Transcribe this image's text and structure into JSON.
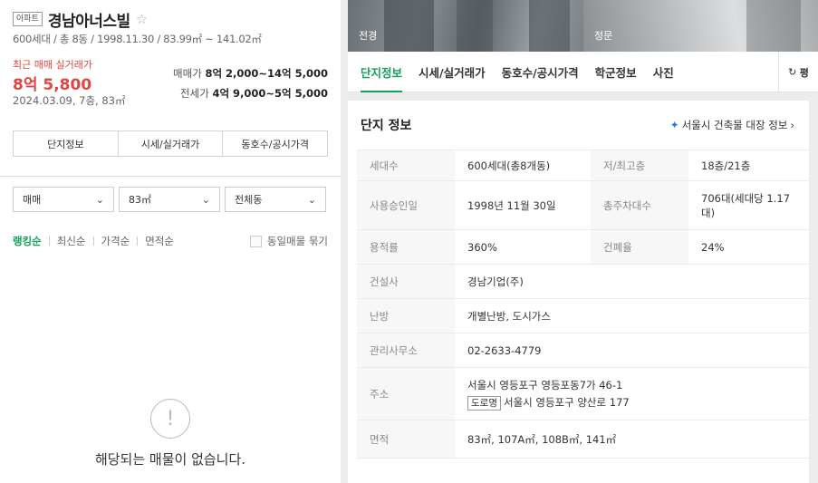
{
  "listing": {
    "type_badge": "아파트",
    "name": "경남아너스빌",
    "star": "☆",
    "summary": "600세대 / 총 8동 / 1998.11.30 / 83.99㎡ ~ 141.02㎡",
    "recent_label": "최근 매매 실거래가",
    "recent_price": "8억 5,800",
    "recent_date": "2024.03.09, 7층, 83㎡",
    "sale_range_label": "매매가",
    "sale_range_value": "8억 2,000~14억 5,000",
    "jeonse_range_label": "전세가",
    "jeonse_range_value": "4억 9,000~5억 5,000",
    "tabs": [
      "단지정보",
      "시세/실거래가",
      "동호수/공시가격"
    ]
  },
  "filters": {
    "deal_type": "매매",
    "area": "83㎡",
    "dong": "전체동"
  },
  "sort": {
    "items": [
      "랭킹순",
      "최신순",
      "가격순",
      "면적순"
    ],
    "same_group_label": "동일매물 묶기"
  },
  "empty_state": {
    "icon": "!",
    "message": "해당되는 매물이 없습니다."
  },
  "photos": [
    {
      "label": "전경"
    },
    {
      "label": "정문"
    }
  ],
  "nav": {
    "items": [
      "단지정보",
      "시세/실거래가",
      "동호수/공시가격",
      "학군정보",
      "사진"
    ],
    "more_label": "평"
  },
  "info": {
    "title": "단지 정보",
    "link_label": "서울시 건축물 대장 정보",
    "rows": [
      {
        "k1": "세대수",
        "v1": "600세대(총8개동)",
        "k2": "저/최고층",
        "v2": "18층/21층"
      },
      {
        "k1": "사용승인일",
        "v1": "1998년 11월 30일",
        "k2": "총주차대수",
        "v2": "706대(세대당 1.17대)"
      },
      {
        "k1": "용적률",
        "v1": "360%",
        "k2": "건폐율",
        "v2": "24%"
      },
      {
        "k1": "건설사",
        "v1": "경남기업(주)"
      },
      {
        "k1": "난방",
        "v1": "개별난방, 도시가스"
      },
      {
        "k1": "관리사무소",
        "v1": "02-2633-4779"
      },
      {
        "k1": "주소",
        "v1": "서울시 영등포구 영등포동7가 46-1",
        "road_badge": "도로명",
        "v1b": "서울시 영등포구 양산로 177"
      },
      {
        "k1": "면적",
        "v1": "83㎡, 107A㎡, 108B㎡, 141㎡"
      }
    ]
  },
  "colors": {
    "accent_green": "#13a05d",
    "price_red": "#e0463f",
    "link_blue": "#2f7de1"
  }
}
